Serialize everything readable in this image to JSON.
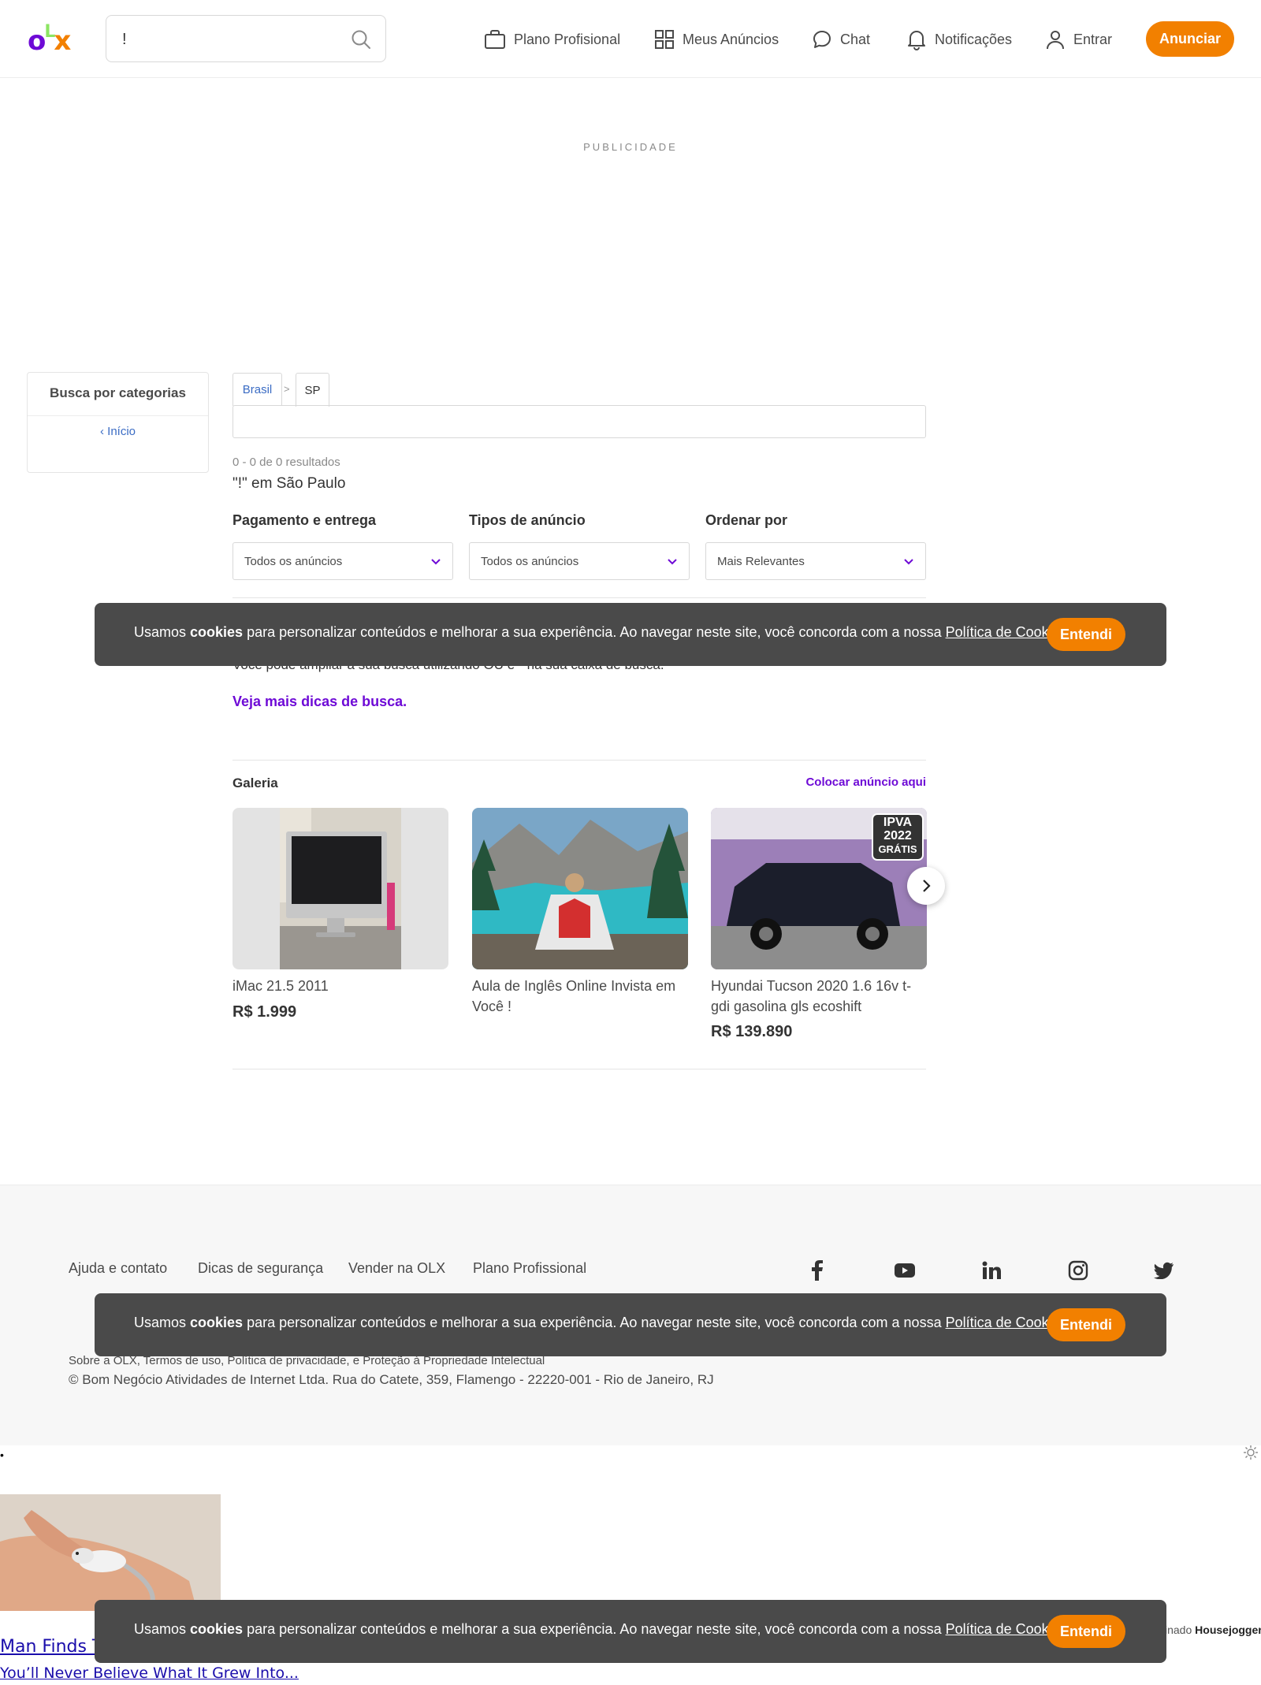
{
  "header": {
    "logo": {
      "o": "o",
      "l": "L",
      "x": "x"
    },
    "search_value": "!",
    "nav": {
      "plano": "Plano Profisional",
      "anuncios": "Meus Anúncios",
      "chat": "Chat",
      "notificacoes": "Notificações",
      "entrar": "Entrar"
    },
    "anunciar": "Anunciar"
  },
  "ad_label": "PUBLICIDADE",
  "sidebar": {
    "title": "Busca por categorias",
    "back": "Início"
  },
  "breadcrumb": {
    "brasil": "Brasil",
    "sep": ">",
    "sp": "SP"
  },
  "results": {
    "count": "0 - 0 de 0 resultados",
    "title": "\"!\" em São Paulo"
  },
  "filters": {
    "pagamento": {
      "label": "Pagamento e entrega",
      "value": "Todos os anúncios"
    },
    "tipos": {
      "label": "Tipos de anúncio",
      "value": "Todos os anúncios"
    },
    "ordenar": {
      "label": "Ordenar por",
      "value": "Mais Relevantes"
    }
  },
  "tips": {
    "text": "Você pode ampliar a sua busca utilizando OU e \" na sua caixa de busca.",
    "link": "Veja mais dicas de busca."
  },
  "gallery": {
    "title": "Galeria",
    "link": "Colocar anúncio aqui",
    "items": [
      {
        "title": "iMac 21.5 2011",
        "price": "R$ 1.999"
      },
      {
        "title": "Aula de Inglês Online Invista em Você !",
        "price": ""
      },
      {
        "title": "Hyundai Tucson 2020 1.6 16v t-gdi gasolina gls ecoshift",
        "price": "R$ 139.890"
      }
    ],
    "badge": [
      "IPVA",
      "2022",
      "GRÁTIS"
    ]
  },
  "footer": {
    "links": {
      "ajuda": "Ajuda e contato",
      "dicas": "Dicas de segurança",
      "vender": "Vender na OLX",
      "plano": "Plano Profissional"
    },
    "legal": "Sobre a OLX, Termos de uso, Política de privacidade, e Proteção à Propriedade Intelectual",
    "copyright": "© Bom Negócio Atividades de Internet Ltda. Rua do Catete, 359, Flamengo - 22220-001 - Rio de Janeiro, RJ"
  },
  "cookie": {
    "pre": "Usamos ",
    "bold": "cookies",
    "mid": " para personalizar conteúdos e melhorar a sua experiência. Ao navegar neste site, você concorda com a nossa ",
    "link": "Política de Cookies",
    "post": ".",
    "button": "Entendi"
  },
  "sponsored": {
    "bullet": "•",
    "title": "Man Finds T",
    "subtitle": "You’ll Never Believe What It Grew Into...",
    "by_prefix": "inado ",
    "by_brand": "Housejogger"
  },
  "colors": {
    "brand_purple": "#6e0ad6",
    "brand_orange": "#f28000",
    "brand_green": "#8ce563",
    "cookie_bg": "#4a4a4a"
  }
}
